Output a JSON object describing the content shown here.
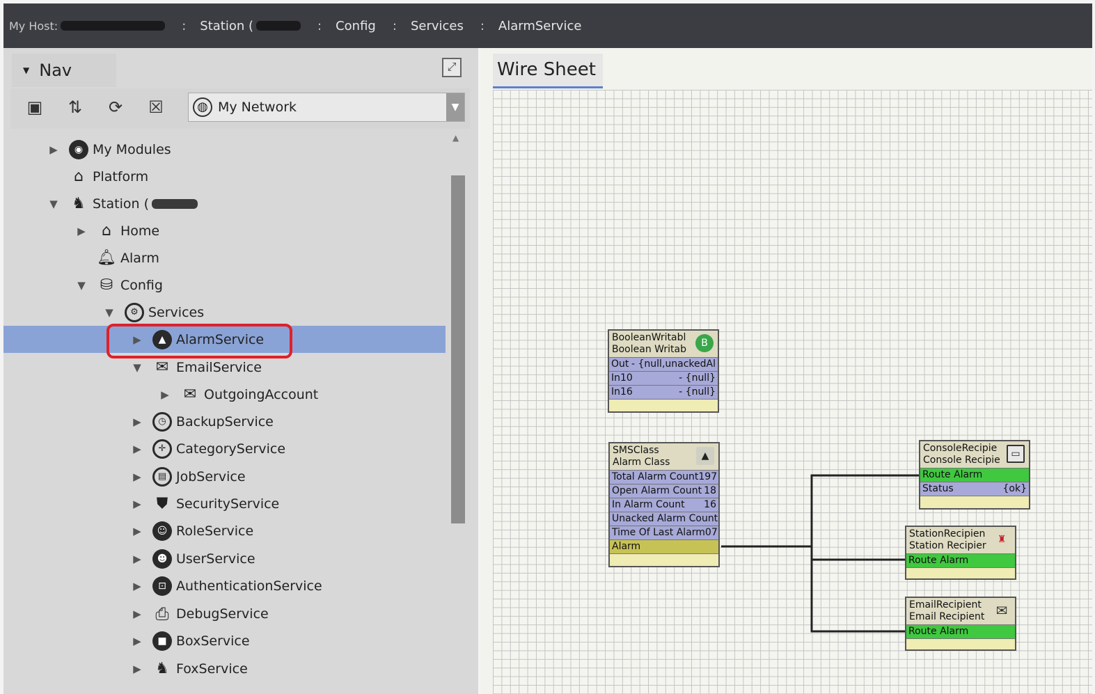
{
  "breadcrumb": {
    "host_label": "My Host:",
    "station_label": "Station (",
    "config_label": "Config",
    "services_label": "Services",
    "alarmservice_label": "AlarmService"
  },
  "nav": {
    "title": "Nav",
    "network_select": "My Network",
    "tree": [
      {
        "label": "My Modules",
        "icon": "modules-icon"
      },
      {
        "label": "Platform",
        "icon": "platform-icon"
      },
      {
        "label": "Station (",
        "icon": "station-icon"
      },
      {
        "label": "Home",
        "icon": "home-icon"
      },
      {
        "label": "Alarm",
        "icon": "bell-icon"
      },
      {
        "label": "Config",
        "icon": "database-icon"
      },
      {
        "label": "Services",
        "icon": "services-icon"
      },
      {
        "label": "AlarmService",
        "icon": "alarm-service-icon"
      },
      {
        "label": "EmailService",
        "icon": "email-icon"
      },
      {
        "label": "OutgoingAccount",
        "icon": "outgoing-mail-icon"
      },
      {
        "label": "BackupService",
        "icon": "backup-icon"
      },
      {
        "label": "CategoryService",
        "icon": "category-icon"
      },
      {
        "label": "JobService",
        "icon": "job-icon"
      },
      {
        "label": "SecurityService",
        "icon": "shield-icon"
      },
      {
        "label": "RoleService",
        "icon": "role-icon"
      },
      {
        "label": "UserService",
        "icon": "user-icon"
      },
      {
        "label": "AuthenticationService",
        "icon": "lock-icon"
      },
      {
        "label": "DebugService",
        "icon": "debug-icon"
      },
      {
        "label": "BoxService",
        "icon": "box-icon"
      },
      {
        "label": "FoxService",
        "icon": "fox-icon"
      }
    ]
  },
  "wiresheet": {
    "tab": "Wire Sheet",
    "boolean_writable": {
      "title1": "BooleanWritabl",
      "title2": "Boolean Writab",
      "badge": "B",
      "slots": [
        {
          "name": "Out",
          "value": "- {null,unackedAl"
        },
        {
          "name": "In10",
          "value": "- {null}"
        },
        {
          "name": "In16",
          "value": "- {null}"
        }
      ]
    },
    "sms_class": {
      "title1": "SMSClass",
      "title2": "Alarm Class",
      "slots": [
        {
          "name": "Total Alarm Count",
          "value": "197"
        },
        {
          "name": "Open Alarm Count",
          "value": "18"
        },
        {
          "name": "In Alarm Count",
          "value": "16"
        },
        {
          "name": "Unacked Alarm Count",
          "value": ""
        },
        {
          "name": "Time Of Last Alarm",
          "value": "07"
        },
        {
          "name": "Alarm",
          "value": ""
        }
      ]
    },
    "console_recipient": {
      "title1": "ConsoleRecipie",
      "title2": "Console Recipie",
      "slots": [
        {
          "name": "Route Alarm",
          "value": ""
        },
        {
          "name": "Status",
          "value": "{ok}"
        }
      ]
    },
    "station_recipient": {
      "title1": "StationRecipien",
      "title2": "Station Recipier",
      "slots": [
        {
          "name": "Route Alarm",
          "value": ""
        }
      ]
    },
    "email_recipient": {
      "title1": "EmailRecipient",
      "title2": "Email Recipient",
      "slots": [
        {
          "name": "Route Alarm",
          "value": ""
        }
      ]
    }
  }
}
